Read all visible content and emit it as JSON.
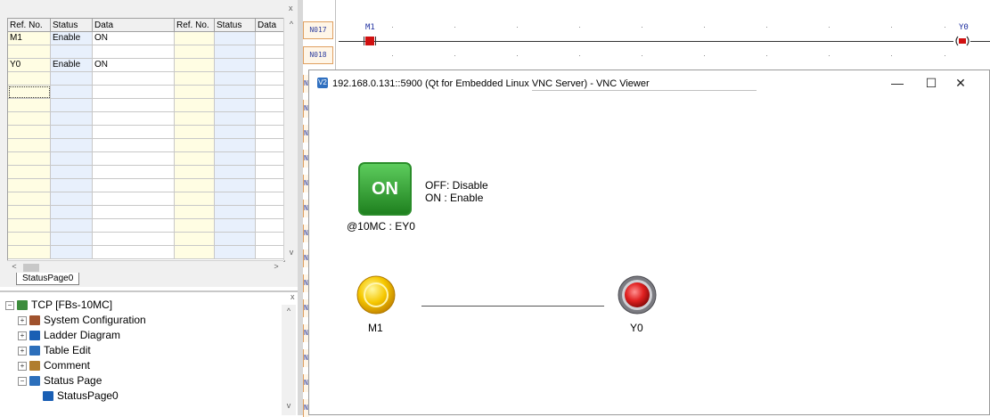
{
  "status_grid": {
    "columns": [
      "Ref. No.",
      "Status",
      "Data",
      "Ref. No.",
      "Status",
      "Data"
    ],
    "rows": [
      {
        "ref": "M1",
        "status": "Enable",
        "data": "ON"
      },
      {
        "ref": "",
        "status": "",
        "data": ""
      },
      {
        "ref": "Y0",
        "status": "Enable",
        "data": "ON"
      }
    ],
    "scroll_left": "<",
    "scroll_right": ">",
    "scroll_up": "^",
    "scroll_down": "v",
    "close": "x"
  },
  "status_tab": {
    "label": "StatusPage0"
  },
  "tree": {
    "close": "x",
    "items": [
      {
        "label": "TCP [FBs-10MC]",
        "toggle": "−",
        "icon_color": "#3c8c3c"
      },
      {
        "label": "System Configuration",
        "toggle": "+",
        "icon_color": "#a0522d"
      },
      {
        "label": "Ladder Diagram",
        "toggle": "+",
        "icon_color": "#1a5fb4"
      },
      {
        "label": "Table Edit",
        "toggle": "+",
        "icon_color": "#2c6fbb"
      },
      {
        "label": "Comment",
        "toggle": "+",
        "icon_color": "#b07d2e"
      },
      {
        "label": "Status Page",
        "toggle": "−",
        "icon_color": "#2c6fbb"
      },
      {
        "label": "StatusPage0",
        "toggle": "",
        "icon_color": "#1a5fb4"
      }
    ]
  },
  "ladder": {
    "rungs": [
      "N017",
      "N018"
    ],
    "contact_label": "M1",
    "coil_label": "Y0",
    "side_rung_prefix": "N"
  },
  "vnc": {
    "title": "192.168.0.131::5900 (Qt for Embedded Linux VNC Server) - VNC Viewer",
    "icon_text": "V2",
    "minimize": "—",
    "maximize": "☐",
    "close": "✕",
    "hmi": {
      "on_button_text": "ON",
      "off_label": "OFF: Disable",
      "on_label": "ON : Enable",
      "binding_label": "@10MC : EY0",
      "m1_label": "M1",
      "y0_label": "Y0"
    }
  },
  "colors": {
    "lamp_yellow": "#f0c000",
    "lamp_red": "#e02020",
    "on_button_green": "#3aa13a",
    "grid_yellow": "#fffde3",
    "grid_blue": "#e8f0fc"
  }
}
